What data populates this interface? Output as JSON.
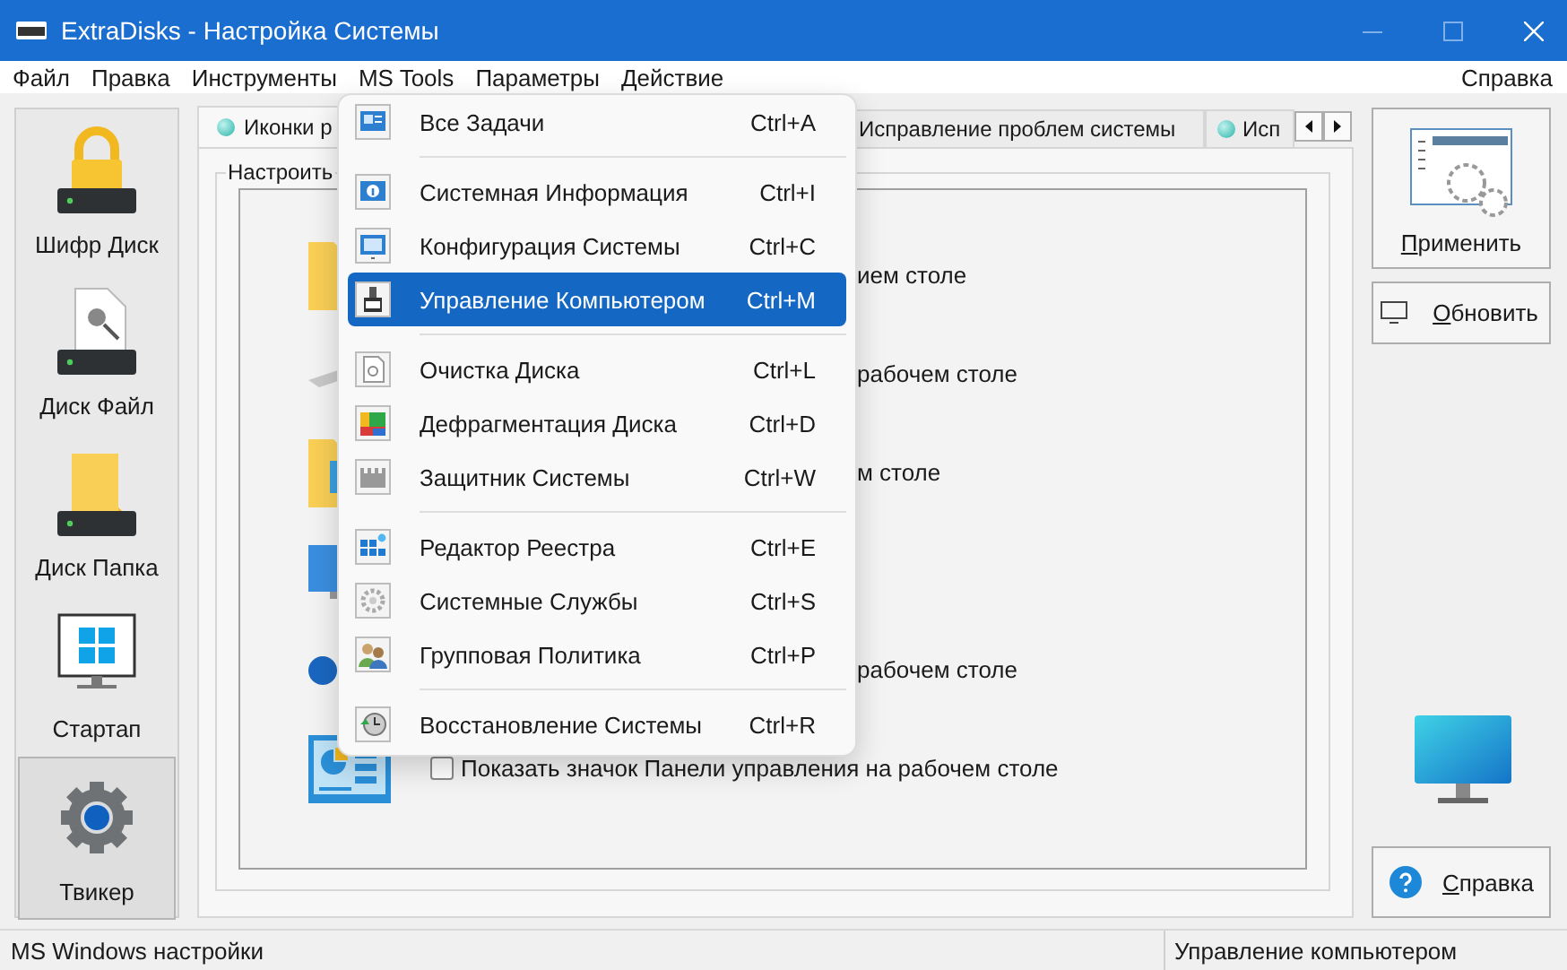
{
  "window": {
    "title": "ExtraDisks - Настройка Системы"
  },
  "menu_bar": {
    "items": [
      "Файл",
      "Правка",
      "Инструменты",
      "MS Tools",
      "Параметры",
      "Действие"
    ],
    "help": "Справка"
  },
  "sidebar": {
    "items": [
      {
        "label": "Шифр Диск",
        "selected": false
      },
      {
        "label": "Диск Файл",
        "selected": false
      },
      {
        "label": "Диск Папка",
        "selected": false
      },
      {
        "label": "Стартап",
        "selected": false
      },
      {
        "label": "Твикер",
        "selected": true
      }
    ]
  },
  "tabs": [
    {
      "label": "Иконки р",
      "selected": true
    },
    {
      "label": "Исправление проблем системы",
      "selected": false
    },
    {
      "label": "Исп",
      "selected": false
    }
  ],
  "group": {
    "title": "Настроить",
    "rows": [
      "ием столе",
      "рабочем столе",
      "м столе",
      "",
      "рабочем столе"
    ],
    "option": {
      "label": "Показать значок Панели управления на рабочем столе",
      "checked": false
    }
  },
  "buttons": {
    "apply": "Применить",
    "refresh": "Обновить",
    "help": "Справка"
  },
  "dropdown": {
    "groups": [
      [
        {
          "label": "Все Задачи",
          "shortcut": "Ctrl+A",
          "selected": false
        }
      ],
      [
        {
          "label": "Системная Информация",
          "shortcut": "Ctrl+I",
          "selected": false
        },
        {
          "label": "Конфигурация Системы",
          "shortcut": "Ctrl+C",
          "selected": false
        },
        {
          "label": "Управление Компьютером",
          "shortcut": "Ctrl+M",
          "selected": true
        }
      ],
      [
        {
          "label": "Очистка Диска",
          "shortcut": "Ctrl+L",
          "selected": false
        },
        {
          "label": "Дефрагментация Диска",
          "shortcut": "Ctrl+D",
          "selected": false
        },
        {
          "label": "Защитник Системы",
          "shortcut": "Ctrl+W",
          "selected": false
        }
      ],
      [
        {
          "label": "Редактор Реестра",
          "shortcut": "Ctrl+E",
          "selected": false
        },
        {
          "label": "Системные Службы",
          "shortcut": "Ctrl+S",
          "selected": false
        },
        {
          "label": "Групповая Политика",
          "shortcut": "Ctrl+P",
          "selected": false
        }
      ],
      [
        {
          "label": "Восстановление Системы",
          "shortcut": "Ctrl+R",
          "selected": false
        }
      ]
    ]
  },
  "status_bar": [
    "MS Windows настройки",
    "Управление компьютером"
  ]
}
